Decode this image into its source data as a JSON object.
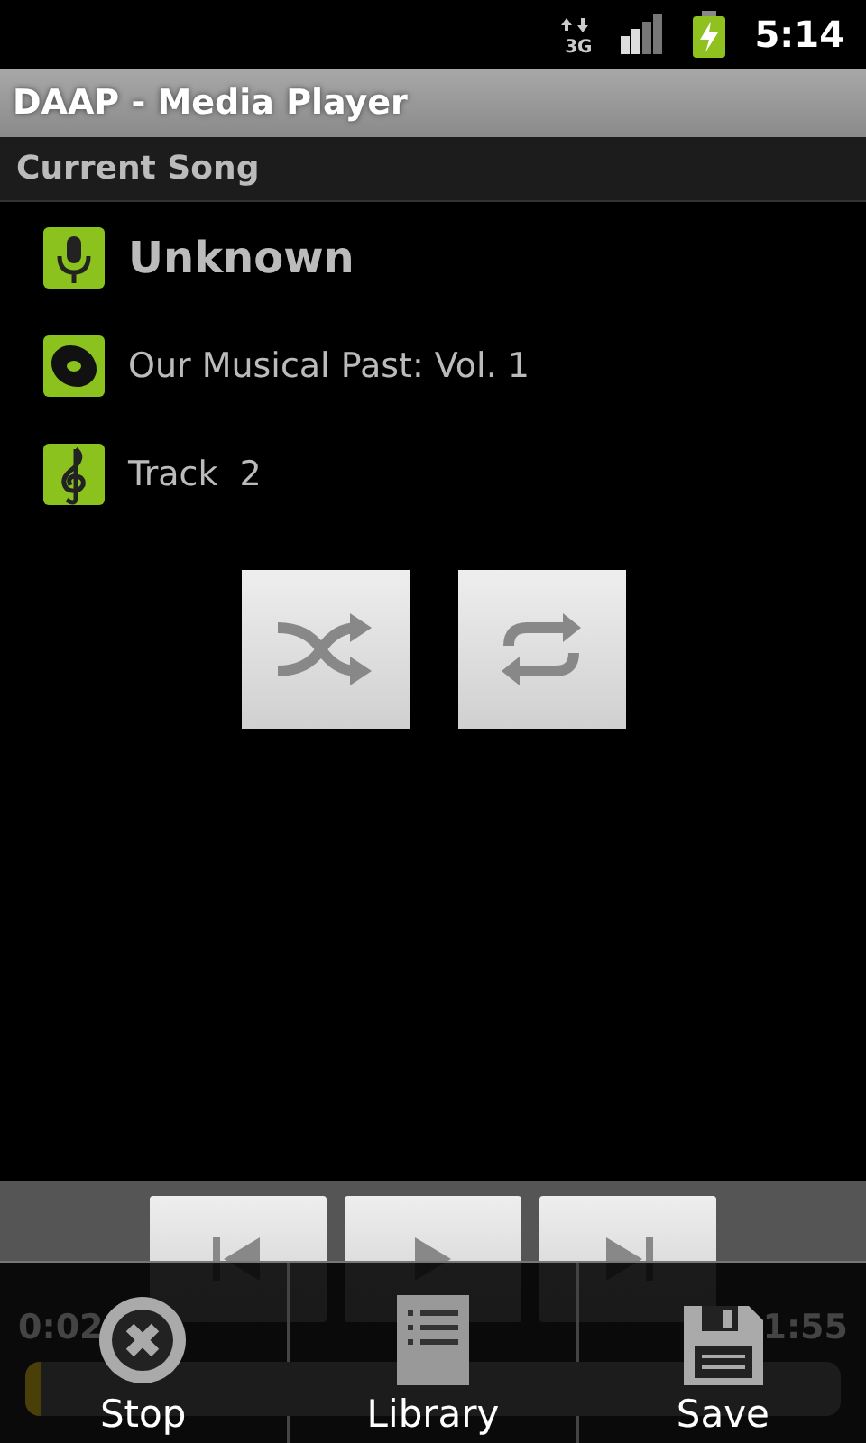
{
  "status_bar": {
    "network": "3G",
    "time": "5:14"
  },
  "window": {
    "title": "DAAP - Media Player"
  },
  "section": {
    "title": "Current Song"
  },
  "song": [
    {
      "kind": "artist",
      "text": "Unknown"
    },
    {
      "kind": "album",
      "text": "Our Musical Past: Vol. 1"
    },
    {
      "kind": "track",
      "text": "Track  2"
    }
  ],
  "toggles": [
    {
      "kind": "shuffle"
    },
    {
      "kind": "repeat"
    }
  ],
  "transport": [
    {
      "kind": "previous"
    },
    {
      "kind": "play"
    },
    {
      "kind": "next"
    }
  ],
  "progress": {
    "elapsed": "0:02",
    "total": "1:55",
    "level": 0.02
  },
  "menu": [
    {
      "kind": "stop",
      "label": "Stop"
    },
    {
      "kind": "library",
      "label": "Library"
    },
    {
      "kind": "save",
      "label": "Save"
    }
  ]
}
